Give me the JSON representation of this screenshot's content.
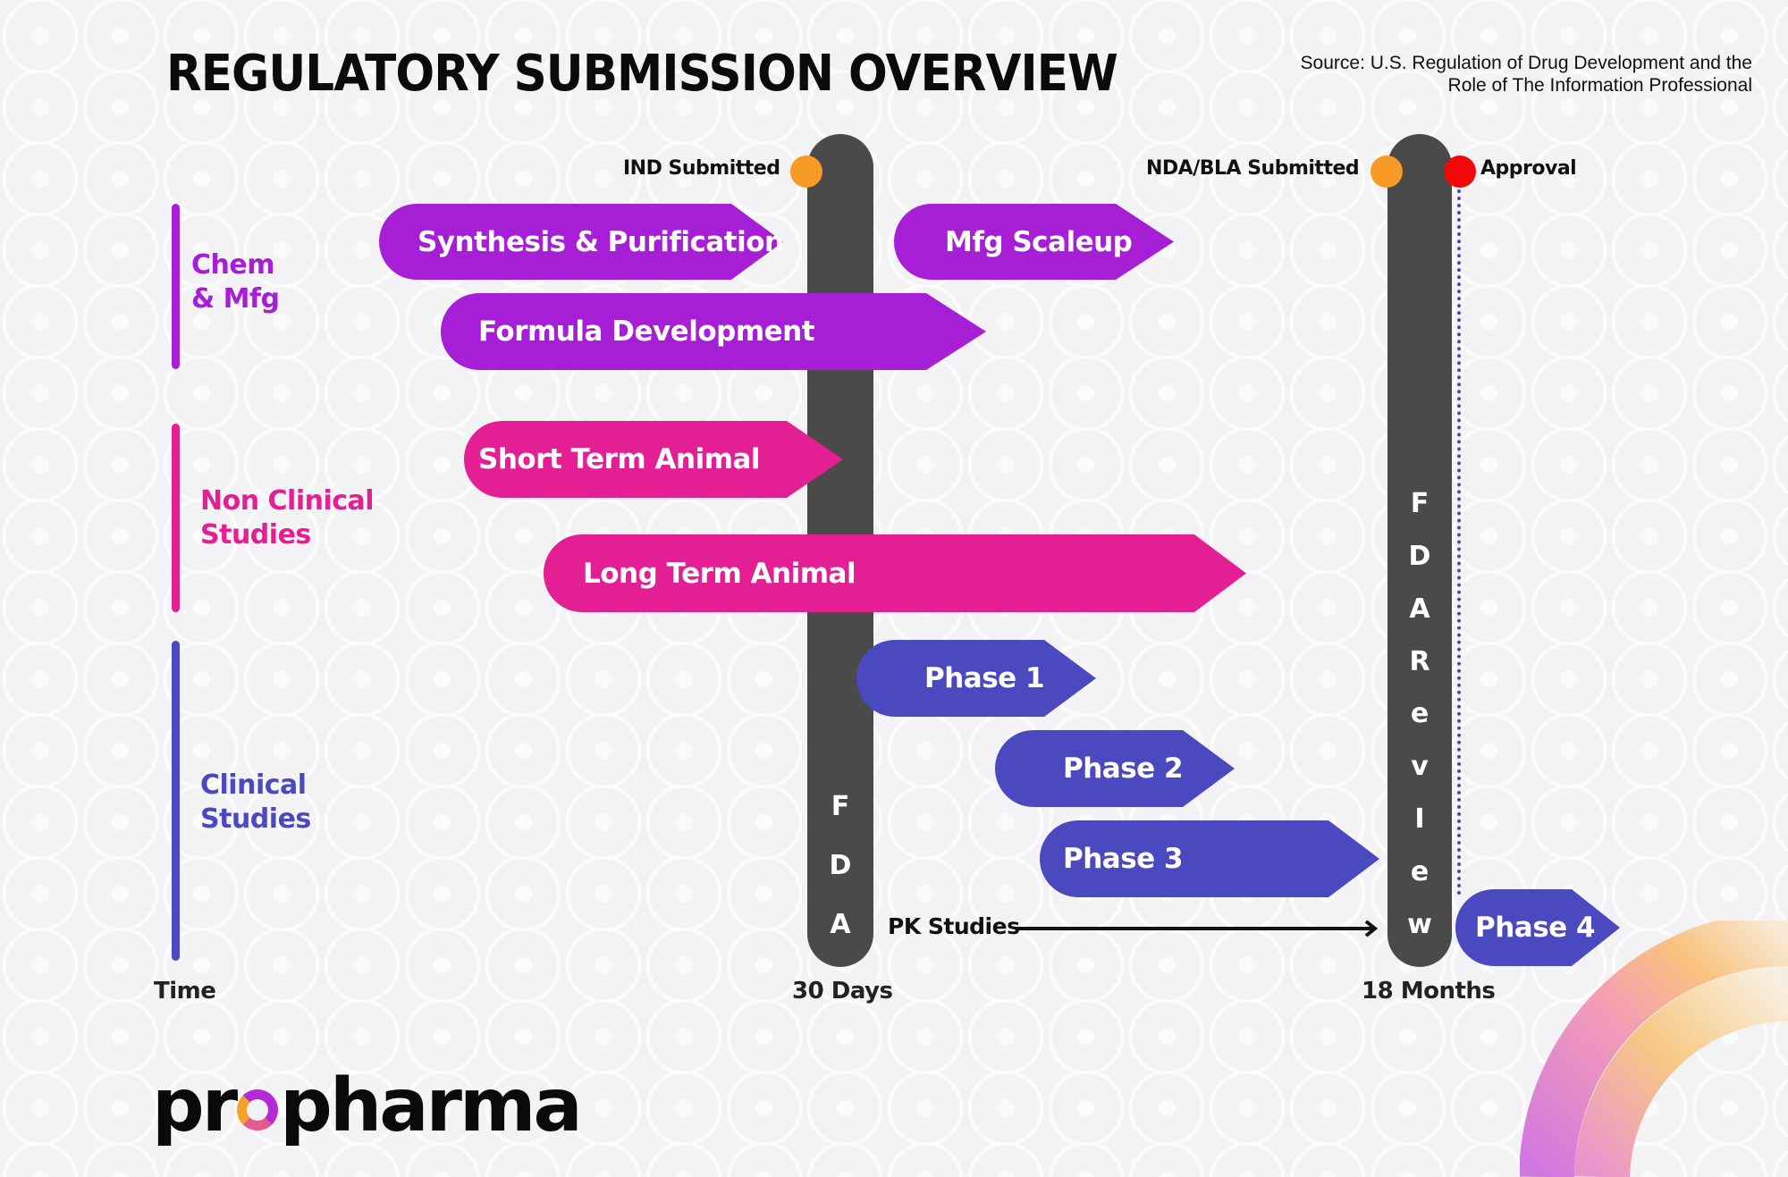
{
  "header": {
    "title": "REGULATORY SUBMISSION OVERVIEW",
    "source_line1": "Source: U.S. Regulation of Drug Development and the",
    "source_line2": "Role of The Information Professional"
  },
  "colors": {
    "chem": "#a61fd6",
    "nonclinical": "#e31f93",
    "clinical": "#4b49c0",
    "fda_bar": "#4a4a4a",
    "milestone_orange": "#f89b24",
    "approval_red": "#f20a0a"
  },
  "categories": [
    {
      "id": "chem",
      "line1": "Chem",
      "line2": "& Mfg"
    },
    {
      "id": "nonclinical",
      "line1": "Non Clinical",
      "line2": "Studies"
    },
    {
      "id": "clinical",
      "line1": "Clinical",
      "line2": "Studies"
    }
  ],
  "milestones": {
    "ind": "IND Submitted",
    "nda": "NDA/BLA Submitted",
    "approval": "Approval"
  },
  "fda_bars": {
    "first": [
      "F",
      "D",
      "A"
    ],
    "second": [
      "F",
      "D",
      "A",
      "R",
      "e",
      "v",
      "I",
      "e",
      "w"
    ]
  },
  "activities": [
    {
      "label": "Synthesis & Purification",
      "category": "chem"
    },
    {
      "label": "Mfg Scaleup",
      "category": "chem"
    },
    {
      "label": "Formula Development",
      "category": "chem"
    },
    {
      "label": "Short Term Animal",
      "category": "nonclinical"
    },
    {
      "label": "Long Term Animal",
      "category": "nonclinical"
    },
    {
      "label": "Phase 1",
      "category": "clinical"
    },
    {
      "label": "Phase 2",
      "category": "clinical"
    },
    {
      "label": "Phase 3",
      "category": "clinical"
    },
    {
      "label": "Phase 4",
      "category": "clinical"
    }
  ],
  "pk_studies": "PK Studies",
  "time_axis": {
    "label": "Time",
    "tick1": "30 Days",
    "tick2": "18 Months"
  },
  "logo": {
    "part1": "pr",
    "part2": "pharma"
  }
}
